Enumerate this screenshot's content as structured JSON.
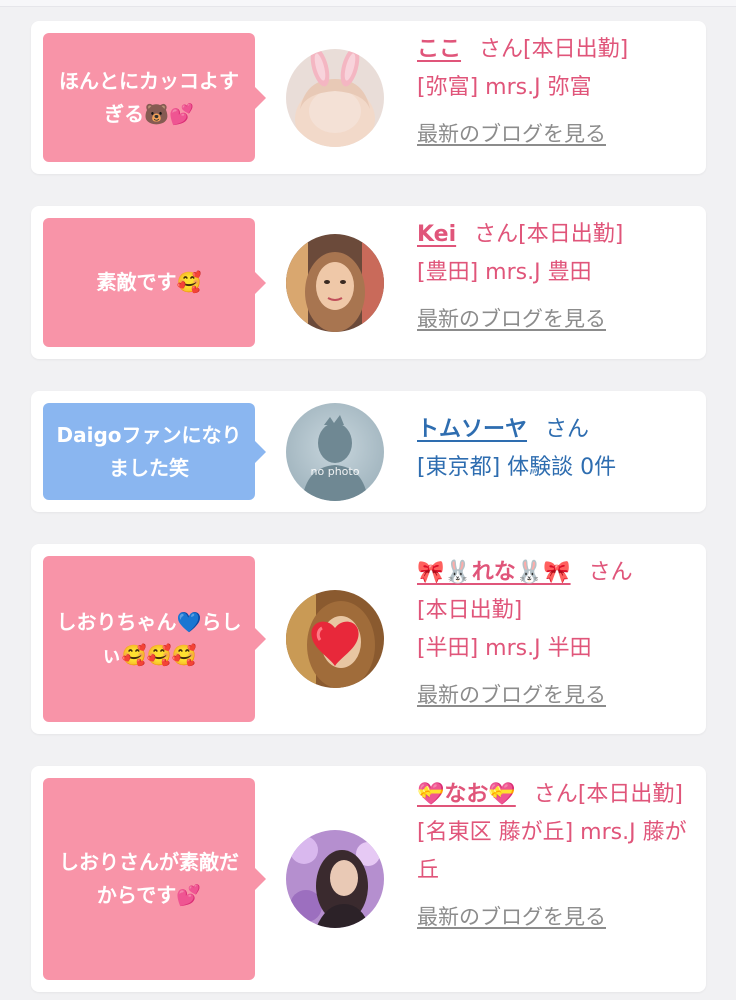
{
  "cards": [
    {
      "message": "ほんとにカッコよすぎる🐻💕",
      "name": "ここ",
      "honorific": "さん",
      "status": "[本日出勤]",
      "shop": "[弥富] mrs.J 弥富",
      "blog_link": "最新のブログを見る"
    },
    {
      "message": "素敵です🥰",
      "name": "Kei",
      "honorific": "さん",
      "status": "[本日出勤]",
      "shop": "[豊田] mrs.J 豊田",
      "blog_link": "最新のブログを見る"
    },
    {
      "message": "Daigoファンになりました笑",
      "name": "トムソーヤ",
      "honorific": "さん",
      "detail": "[東京都] 体験談 0件",
      "avatar_text": "no photo"
    },
    {
      "message": "しおりちゃん💙らしぃ🥰🥰🥰",
      "name": "🎀🐰れな🐰🎀",
      "honorific": "さん",
      "status": "[本日出勤]",
      "shop": "[半田] mrs.J 半田",
      "blog_link": "最新のブログを見る"
    },
    {
      "message": "しおりさんが素敵だからです💕",
      "name": "💝なお💝",
      "honorific": "さん",
      "status": "[本日出勤]",
      "shop": "[名東区 藤が丘] mrs.J 藤が丘",
      "blog_link": "最新のブログを見る"
    }
  ],
  "colors": {
    "pink_bubble": "#f894a8",
    "blue_bubble": "#8ab6f0",
    "pink_text": "#e0557a",
    "blue_text": "#2e6db0",
    "link_gray": "#8c8c8c",
    "background": "#f1f1f3"
  }
}
